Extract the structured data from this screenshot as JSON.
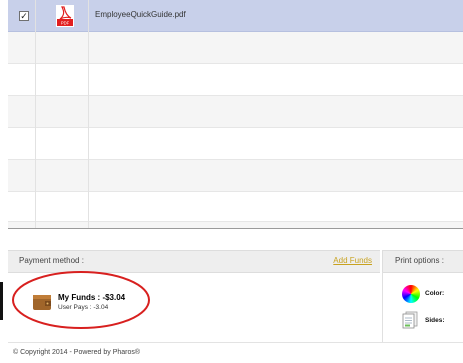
{
  "file_list": {
    "files": [
      {
        "name": "EmployeeQuickGuide.pdf",
        "checked": true,
        "icon": "pdf-icon",
        "icon_label": "PDF"
      }
    ]
  },
  "payment": {
    "title": "Payment method :",
    "add_funds": "Add Funds",
    "funds_label": "My Funds : -$3.04",
    "user_pays": "User Pays : -3.04",
    "icon": "wallet-icon"
  },
  "print_options": {
    "title": "Print options :",
    "color_label": "Color:",
    "sides_label": "Sides:"
  },
  "footer": {
    "copyright": "© Copyright 2014 - Powered by Pharos®"
  },
  "colors": {
    "selected_row": "#c8d0ea",
    "highlight_circle": "#d8201f",
    "add_funds_link": "#c8a21f"
  }
}
